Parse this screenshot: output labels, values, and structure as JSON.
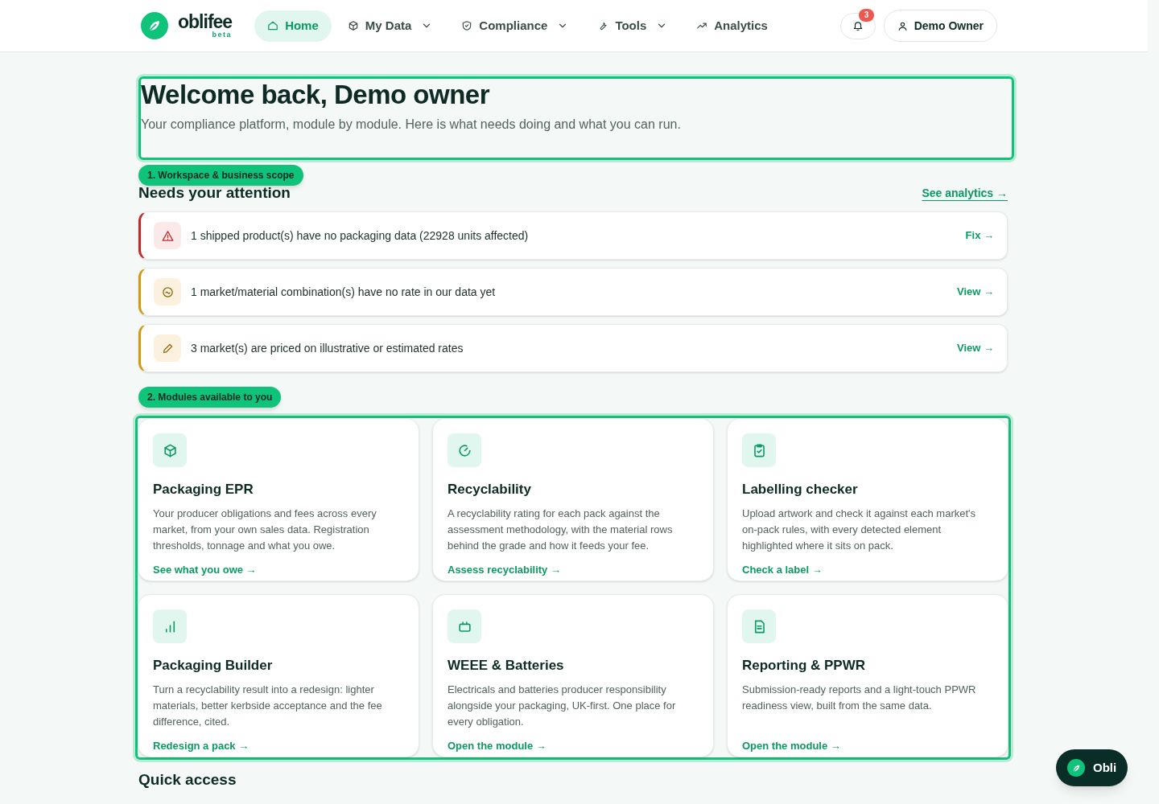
{
  "header": {
    "logo": {
      "name": "oblifee",
      "tag": "beta"
    },
    "nav": [
      {
        "label": "Home",
        "selected": true,
        "dropdown": false
      },
      {
        "label": "My Data",
        "selected": false,
        "dropdown": true
      },
      {
        "label": "Compliance",
        "selected": false,
        "dropdown": true
      },
      {
        "label": "Tools",
        "selected": false,
        "dropdown": true
      },
      {
        "label": "Analytics",
        "selected": false,
        "dropdown": false
      }
    ],
    "notifications": {
      "count": "3"
    },
    "user": {
      "name": "Demo Owner"
    }
  },
  "welcome": {
    "title": "Welcome back, Demo owner",
    "subtitle": "Your compliance platform, module by module. Here is what needs doing and what you can run."
  },
  "tour_steps": [
    "1. Workspace & business scope",
    "2. Modules available to you"
  ],
  "attention": {
    "title": "Needs your attention",
    "link": "See analytics →",
    "alerts": [
      {
        "kind": "critical",
        "text": "1 shipped product(s) have no packaging data (22928 units affected)",
        "action": "Fix →"
      },
      {
        "kind": "warning",
        "text": "1 market/material combination(s) have no rate in our data yet",
        "action": "View →"
      },
      {
        "kind": "warning",
        "text": "3 market(s) are priced on illustrative or estimated rates",
        "action": "View →"
      }
    ]
  },
  "modules": [
    {
      "title": "Packaging EPR",
      "description": "Your producer obligations and fees across every market, from your own sales data. Registration thresholds, tonnage and what you owe.",
      "link": "See what you owe →"
    },
    {
      "title": "Recyclability",
      "description": "A recyclability rating for each pack against the assessment methodology, with the material rows behind the grade and how it feeds your fee.",
      "link": "Assess recyclability →"
    },
    {
      "title": "Labelling checker",
      "description": "Upload artwork and check it against each market's on-pack rules, with every detected element highlighted where it sits on pack.",
      "link": "Check a label →"
    },
    {
      "title": "Packaging Builder",
      "description": "Turn a recyclability result into a redesign: lighter materials, better kerbside acceptance and the fee difference, cited.",
      "link": "Redesign a pack →"
    },
    {
      "title": "WEEE & Batteries",
      "description": "Electricals and batteries producer responsibility alongside your packaging, UK-first. One place for every obligation.",
      "link": "Open the module →"
    },
    {
      "title": "Reporting & PPWR",
      "description": "Submission-ready reports and a light-touch PPWR readiness view, built from the same data.",
      "link": "Open the module →"
    }
  ],
  "quick_access": {
    "title": "Quick access"
  },
  "assistant": {
    "label": "Obli"
  }
}
